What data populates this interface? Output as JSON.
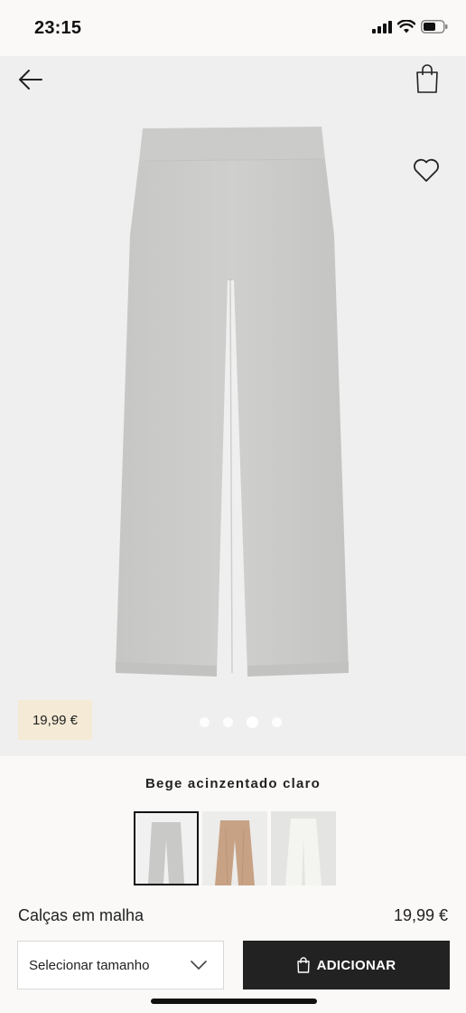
{
  "status_bar": {
    "time": "23:15",
    "icons": [
      "signal-icon",
      "wifi-icon",
      "battery-icon"
    ]
  },
  "header": {
    "back_icon": "arrow-left-icon",
    "bag_icon": "shopping-bag-icon",
    "wishlist_icon": "heart-icon"
  },
  "gallery": {
    "price_tag": "19,99 €",
    "image_count": 4,
    "active_image_index": 2
  },
  "color": {
    "selected_name": "Bege acinzentado claro",
    "swatches": [
      {
        "color": "#c9c9c7",
        "selected": true
      },
      {
        "color": "#c7a285",
        "selected": false
      },
      {
        "color": "#efefea",
        "selected": false
      }
    ]
  },
  "product": {
    "name": "Calças em malha",
    "price": "19,99 €"
  },
  "actions": {
    "size_placeholder": "Selecionar tamanho",
    "add_label": "ADICIONAR"
  },
  "colors": {
    "accent_dark": "#222222",
    "price_tag_bg": "#f4ead5",
    "hero_bg": "#efefef"
  }
}
